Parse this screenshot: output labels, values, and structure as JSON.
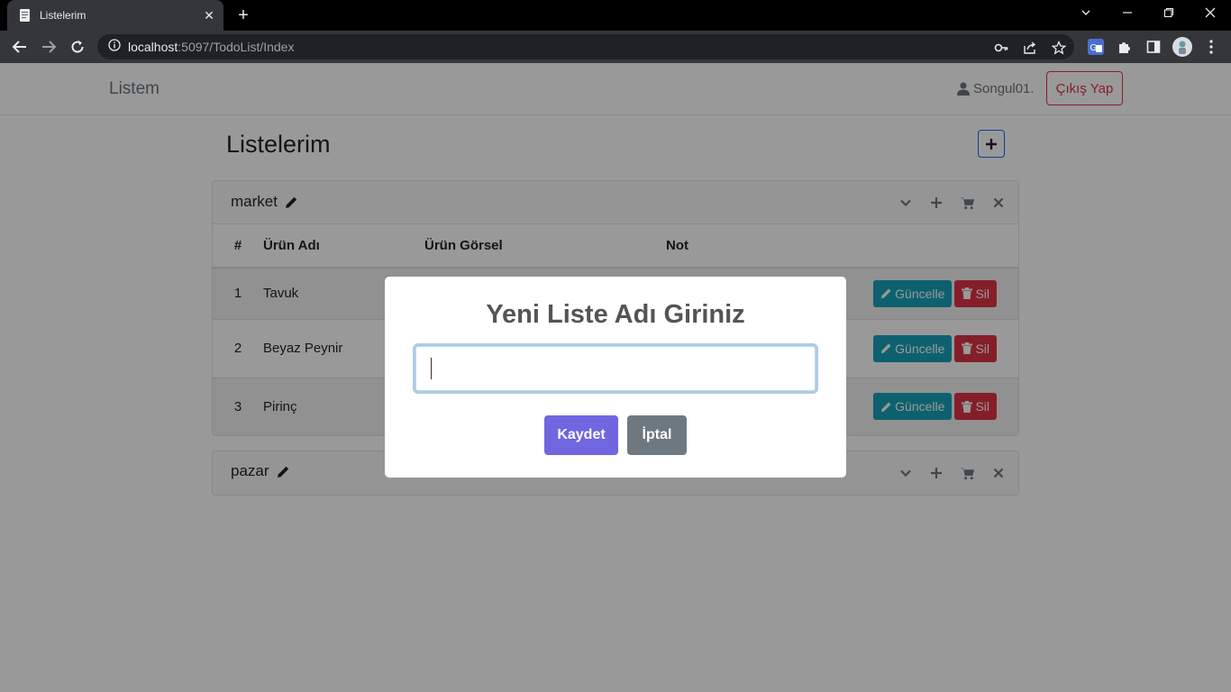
{
  "browser": {
    "tab_title": "Listelerim",
    "url_host": "localhost",
    "url_path": ":5097/TodoList/Index"
  },
  "navbar": {
    "brand": "Listem",
    "username": "Songul01.",
    "logout_label": "Çıkış Yap"
  },
  "main": {
    "title": "Listelerim"
  },
  "table_headers": [
    "#",
    "Ürün Adı",
    "Ürün Görsel",
    "Not"
  ],
  "lists": [
    {
      "name": "market",
      "items": [
        {
          "index": "1",
          "name": "Tavuk"
        },
        {
          "index": "2",
          "name": "Beyaz Peynir"
        },
        {
          "index": "3",
          "name": "Pirinç"
        }
      ]
    },
    {
      "name": "pazar",
      "items": []
    }
  ],
  "row_actions": {
    "update_label": "Güncelle",
    "delete_label": "Sil"
  },
  "modal": {
    "title": "Yeni Liste Adı Giriniz",
    "input_value": "",
    "save_label": "Kaydet",
    "cancel_label": "İptal"
  },
  "colors": {
    "update_button": "#17a2b8",
    "delete_button": "#dc3545",
    "save_button": "#7066e0",
    "cancel_button": "#6e7881"
  }
}
